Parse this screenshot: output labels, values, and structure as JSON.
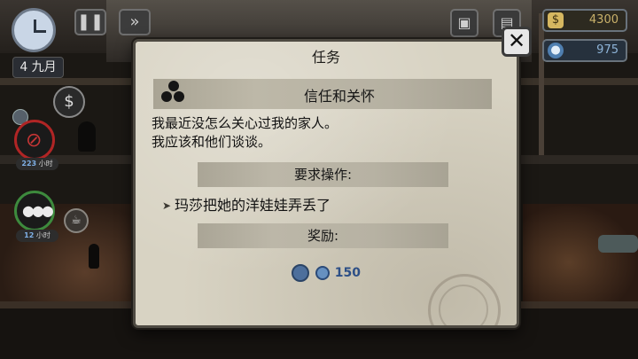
{
  "hud": {
    "date": "4 九月",
    "pause_icon": "pause-icon",
    "fast_forward_icon": "fast-forward-icon",
    "money_icon": "dollar-icon",
    "money_value": "4300",
    "reputation_value": "975",
    "characters": [
      {
        "label_num": "223",
        "label_unit": "小时",
        "status_color": "#b02525"
      },
      {
        "label_num": "12",
        "label_unit": "小时",
        "status_color": "#3d8a3d"
      }
    ]
  },
  "dialog": {
    "title": "任务",
    "task_name": "信任和关怀",
    "description_lines": [
      "我最近没怎么关心过我的家人。",
      "我应该和他们谈谈。"
    ],
    "requirements_label": "要求操作:",
    "requirement": "玛莎把她的洋娃娃弄丢了",
    "rewards_label": "奖励:",
    "reward_value": "150",
    "close_symbol": "✕"
  },
  "colors": {
    "panel": "#d8d3c3",
    "section_bar": "#b7b2a3",
    "reward_blue": "#2d4f86"
  }
}
